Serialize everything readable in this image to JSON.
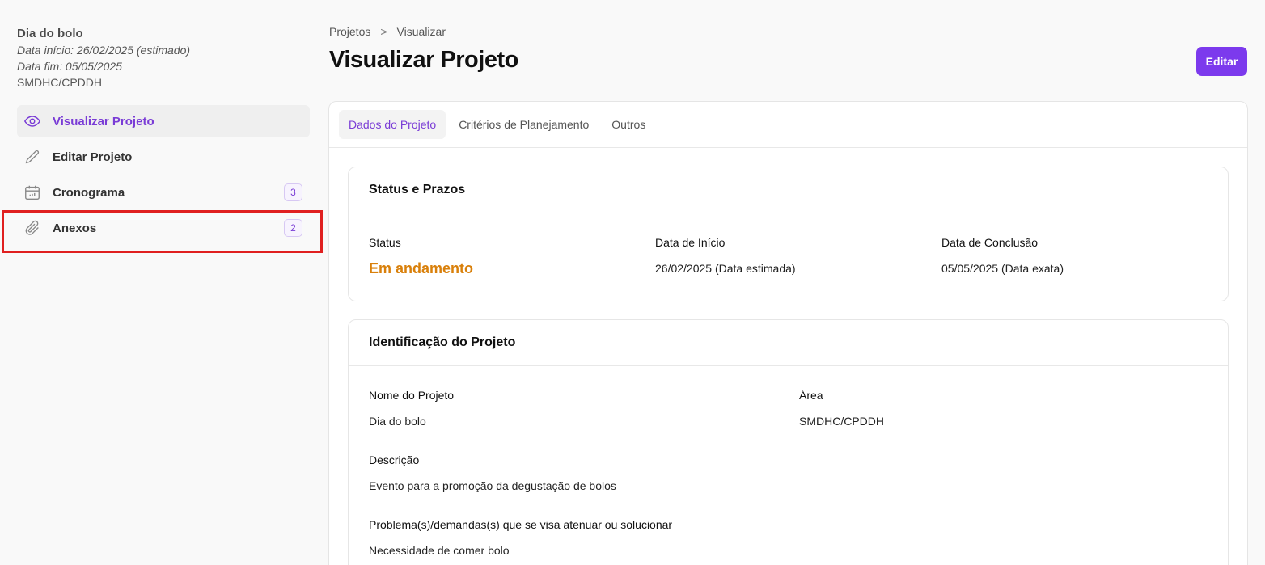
{
  "project": {
    "title": "Dia do bolo",
    "start": "Data início: 26/02/2025 (estimado)",
    "end": "Data fim: 05/05/2025",
    "area": "SMDHC/CPDDH"
  },
  "sidebar": {
    "items": [
      {
        "label": "Visualizar Projeto",
        "icon": "eye-icon",
        "active": true
      },
      {
        "label": "Editar Projeto",
        "icon": "pencil-icon"
      },
      {
        "label": "Cronograma",
        "icon": "calendar-icon",
        "badge": "3"
      },
      {
        "label": "Anexos",
        "icon": "paperclip-icon",
        "badge": "2"
      }
    ]
  },
  "breadcrumb": {
    "items": [
      "Projetos",
      "Visualizar"
    ],
    "separator": ">"
  },
  "header": {
    "title": "Visualizar Projeto",
    "edit_label": "Editar"
  },
  "tabs": [
    {
      "label": "Dados do Projeto",
      "active": true
    },
    {
      "label": "Critérios de Planejamento"
    },
    {
      "label": "Outros"
    }
  ],
  "status_section": {
    "title": "Status e Prazos",
    "status_label": "Status",
    "status_value": "Em andamento",
    "start_label": "Data de Início",
    "start_value": "26/02/2025 (Data estimada)",
    "end_label": "Data de Conclusão",
    "end_value": "05/05/2025 (Data exata)"
  },
  "ident_section": {
    "title": "Identificação do Projeto",
    "name_label": "Nome do Projeto",
    "name_value": "Dia do bolo",
    "area_label": "Área",
    "area_value": "SMDHC/CPDDH",
    "desc_label": "Descrição",
    "desc_value": "Evento para a promoção da degustação de bolos",
    "problem_label": "Problema(s)/demandas(s) que se visa atenuar ou solucionar",
    "problem_value": "Necessidade de comer bolo"
  },
  "colors": {
    "accent": "#7c3aed",
    "status": "#d9800b",
    "highlight": "#e02020"
  }
}
